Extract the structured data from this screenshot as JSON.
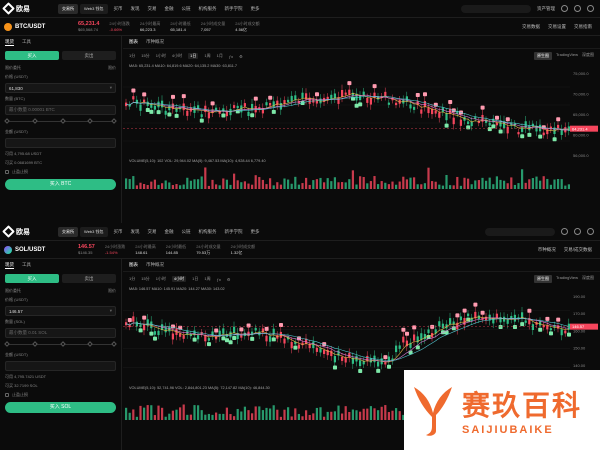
{
  "screen1": {
    "brand": "欧易",
    "tabs": [
      "交易所",
      "Web3 钱包"
    ],
    "nav": [
      "买币",
      "发现",
      "交易",
      "金融",
      "公链",
      "机构服务",
      "新手学院",
      "更多"
    ],
    "right_menu": [
      "资产管理"
    ],
    "pair": "BTC/USDT",
    "price": "65,231.4",
    "price_sub": "$65,568.74",
    "stats": [
      {
        "k": "24小时涨跌",
        "v": "-0.66%"
      },
      {
        "k": "24小时最高",
        "v": "66,223.3"
      },
      {
        "k": "24小时最低",
        "v": "65,181.4"
      },
      {
        "k": "24小时成交量",
        "v": "7,057"
      },
      {
        "k": "24小时成交额",
        "v": "4.56亿"
      }
    ],
    "tick_right": [
      "交易数据",
      "交易设置",
      "交易指南"
    ],
    "left_tabs": [
      "现货",
      "工具"
    ],
    "buy_label": "买入",
    "sell_label": "卖出",
    "order_type_label": "限价委托",
    "order_type_value": "限价",
    "price_label": "价格 (USDT)",
    "price_value": "61,830",
    "qty_label": "数量 (BTC)",
    "qty_placeholder": "最小数量 0.00001 BTC",
    "total_label": "金额 (USDT)",
    "avail": "可用 4,795.68 USDT",
    "max_buy": "可买 0.0681699 BTC",
    "tp_label": "止盈止损",
    "big_button": "买入 BTC",
    "chart_tabs": [
      "图表",
      "币种概况"
    ],
    "timeframes": [
      "1分",
      "15分",
      "1小时",
      "4小时",
      "1日",
      "1周",
      "1月"
    ],
    "active_tf": "1日",
    "view_modes": [
      "原生图",
      "TradingView",
      "深度图"
    ],
    "ma_line": "MA5: 65,231.4  MA10: 64,819.6  MA20: 64,135.2  MA30: 63,811.7",
    "vol_line": "VOLUME(5,10): 102   VOL: 29,944.02   MA(5): 9,467.53   MA(10): 4,928.44   6,779.40",
    "price_axis": [
      "75,000.0",
      "70,000.0",
      "65,000.0",
      "60,000.0",
      "56,000.0"
    ],
    "last_price_tag": "64,231.4",
    "low_label": "56,555.0",
    "high_label": "72,777.0"
  },
  "screen2": {
    "brand": "欧易",
    "tabs": [
      "交易所",
      "Web3 钱包"
    ],
    "nav": [
      "买币",
      "发现",
      "交易",
      "金融",
      "公链",
      "机构服务",
      "新手学院",
      "更多"
    ],
    "pair": "SOL/USDT",
    "price": "146.57",
    "price_sub": "$146.35",
    "stats": [
      {
        "k": "24小时涨跌",
        "v": "-1.54%"
      },
      {
        "k": "24小时最高",
        "v": "148.61"
      },
      {
        "k": "24小时最低",
        "v": "144.85"
      },
      {
        "k": "24小时成交量",
        "v": "79.53万"
      },
      {
        "k": "24小时成交额",
        "v": "1.32亿"
      }
    ],
    "tick_right": [
      "币种概况",
      "交易/成交数据"
    ],
    "left_tabs": [
      "现货",
      "工具"
    ],
    "buy_label": "买入",
    "sell_label": "卖出",
    "order_type_label": "限价委托",
    "order_type_value": "限价",
    "price_label": "价格 (USDT)",
    "price_value": "146.57",
    "qty_label": "数量 (SOL)",
    "qty_placeholder": "最小数量 0.01 SOL",
    "total_label": "金额 (USDT)",
    "avail": "可用 4,795.7421 USDT",
    "max_buy": "可买 32.7199 SOL",
    "tp_label": "止盈止损",
    "big_button": "买入 SOL",
    "chart_tabs": [
      "图表",
      "币种概况"
    ],
    "timeframes": [
      "1分",
      "15分",
      "1小时",
      "4小时",
      "1日",
      "1周"
    ],
    "active_tf": "4小时",
    "view_modes": [
      "原生图",
      "TradingView",
      "深度图"
    ],
    "ma_line": "MA5: 146.57  MA10: 145.91  MA20: 144.27  MA30: 143.02",
    "vol_line": "VOLUME(5,10): 52,741.96   VOL: 2,844,801.23   MA(5): 72,147.82   MA(10): 46,844.30",
    "price_axis": [
      "190.00",
      "170.00",
      "160.00",
      "150.00",
      "140.00",
      "130.00"
    ],
    "last_price_tag": "146.57",
    "high_label": "165.02",
    "low_label": "121.30"
  },
  "watermark": {
    "cn": "赛玖百科",
    "en": "SAIJIUBAIKE"
  },
  "colors": {
    "up": "#2ebd85",
    "down": "#f6465d",
    "accent": "#ffffff",
    "watermark": "#ef6a2e"
  }
}
